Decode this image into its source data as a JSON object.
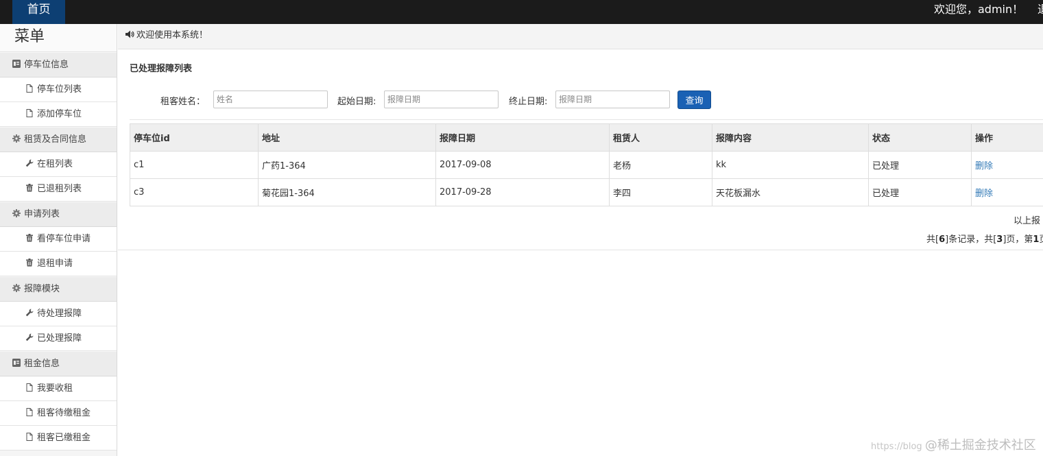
{
  "topbar": {
    "home_label": "首页",
    "welcome_text": "欢迎您，admin！",
    "logout_text": "退"
  },
  "sidebar": {
    "title": "菜单",
    "groups": [
      {
        "label": "停车位信息",
        "icon": "id-card-icon",
        "items": [
          {
            "label": "停车位列表",
            "icon": "file-icon"
          },
          {
            "label": "添加停车位",
            "icon": "file-icon"
          }
        ]
      },
      {
        "label": "租赁及合同信息",
        "icon": "gear-icon",
        "items": [
          {
            "label": "在租列表",
            "icon": "wrench-icon"
          },
          {
            "label": "已退租列表",
            "icon": "trash-icon"
          }
        ]
      },
      {
        "label": "申请列表",
        "icon": "gear-icon",
        "items": [
          {
            "label": "看停车位申请",
            "icon": "trash-icon"
          },
          {
            "label": "退租申请",
            "icon": "trash-icon"
          }
        ]
      },
      {
        "label": "报障模块",
        "icon": "gear-icon",
        "items": [
          {
            "label": "待处理报障",
            "icon": "wrench-icon"
          },
          {
            "label": "已处理报障",
            "icon": "wrench-icon"
          }
        ]
      },
      {
        "label": "租金信息",
        "icon": "id-card-icon",
        "items": [
          {
            "label": "我要收租",
            "icon": "file-icon"
          },
          {
            "label": "租客待缴租金",
            "icon": "file-icon"
          },
          {
            "label": "租客已缴租金",
            "icon": "file-icon"
          }
        ]
      }
    ]
  },
  "notice": {
    "icon": "volume-icon",
    "text": "欢迎使用本系统！"
  },
  "page": {
    "title": "已处理报障列表"
  },
  "search": {
    "tenant_label": "租客姓名：",
    "tenant_placeholder": "姓名",
    "start_label": "起始日期:",
    "start_placeholder": "报障日期",
    "end_label": "终止日期:",
    "end_placeholder": "报障日期",
    "query_label": "查询"
  },
  "table": {
    "headers": [
      "停车位id",
      "地址",
      "报障日期",
      "租赁人",
      "报障内容",
      "状态",
      "操作"
    ],
    "rows": [
      {
        "id": "c1",
        "address": "广药1-364",
        "date": "2017-09-08",
        "tenant": "老杨",
        "content": "kk",
        "status": "已处理",
        "action": "删除"
      },
      {
        "id": "c3",
        "address": "菊花园1-364",
        "date": "2017-09-28",
        "tenant": "李四",
        "content": "天花板漏水",
        "status": "已处理",
        "action": "删除"
      }
    ]
  },
  "summary": "以上报",
  "pagination": {
    "total_prefix": "共[",
    "total_records": "6",
    "total_mid": "]条记录，共[",
    "total_pages": "3",
    "page_mid": "]页，第",
    "current_page": "1",
    "page_suffix": "页 |"
  },
  "watermark": {
    "prefix": "https://blog",
    "text": "@稀土掘金技术社区"
  }
}
